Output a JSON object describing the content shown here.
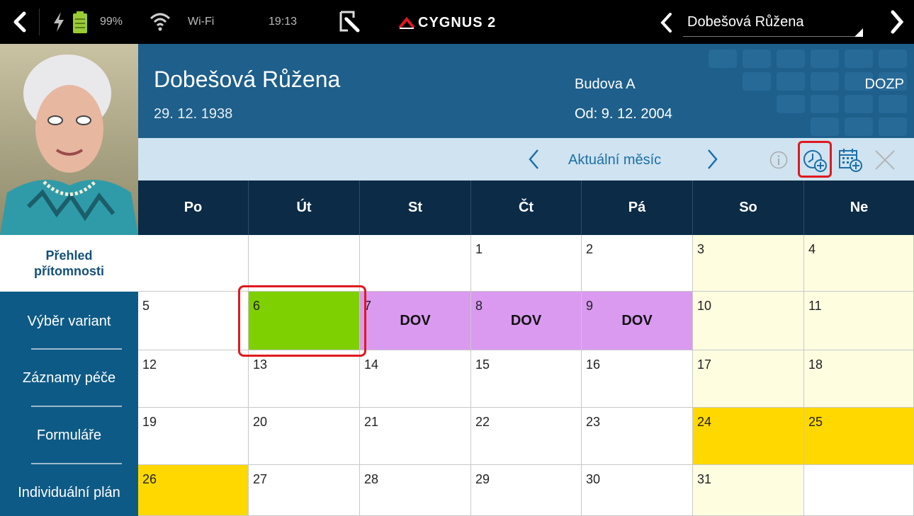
{
  "status_bar": {
    "battery_percent": "99%",
    "wifi_label": "Wi-Fi",
    "time": "19:13",
    "app_logo": "CYGNUS 2",
    "selected_patient": "Dobešová Růžena"
  },
  "patient": {
    "name": "Dobešová Růžena",
    "birth_date": "29. 12. 1938",
    "building": "Budova A",
    "since": "Od: 9. 12. 2004",
    "service": "DOZP"
  },
  "month_nav": {
    "label": "Aktuální měsíc"
  },
  "sidebar": {
    "active": "Přehled přítomnosti",
    "items": [
      {
        "label": "Výběr variant"
      },
      {
        "label": "Záznamy péče"
      },
      {
        "label": "Formuláře"
      },
      {
        "label": "Individuální plán"
      }
    ]
  },
  "calendar": {
    "weekdays": [
      "Po",
      "Út",
      "St",
      "Čt",
      "Pá",
      "So",
      "Ne"
    ],
    "weeks": [
      [
        {
          "day": ""
        },
        {
          "day": ""
        },
        {
          "day": ""
        },
        {
          "day": "1"
        },
        {
          "day": "2"
        },
        {
          "day": "3",
          "kind": "weekend"
        },
        {
          "day": "4",
          "kind": "weekend"
        }
      ],
      [
        {
          "day": "5"
        },
        {
          "day": "6",
          "kind": "present"
        },
        {
          "day": "7",
          "kind": "leave",
          "tag": "DOV"
        },
        {
          "day": "8",
          "kind": "leave",
          "tag": "DOV"
        },
        {
          "day": "9",
          "kind": "leave",
          "tag": "DOV"
        },
        {
          "day": "10",
          "kind": "weekend"
        },
        {
          "day": "11",
          "kind": "weekend"
        }
      ],
      [
        {
          "day": "12"
        },
        {
          "day": "13"
        },
        {
          "day": "14"
        },
        {
          "day": "15"
        },
        {
          "day": "16"
        },
        {
          "day": "17",
          "kind": "weekend"
        },
        {
          "day": "18",
          "kind": "weekend"
        }
      ],
      [
        {
          "day": "19"
        },
        {
          "day": "20"
        },
        {
          "day": "21"
        },
        {
          "day": "22"
        },
        {
          "day": "23"
        },
        {
          "day": "24",
          "kind": "holiday"
        },
        {
          "day": "25",
          "kind": "holiday"
        }
      ],
      [
        {
          "day": "26",
          "kind": "holiday"
        },
        {
          "day": "27"
        },
        {
          "day": "28"
        },
        {
          "day": "29"
        },
        {
          "day": "30"
        },
        {
          "day": "31",
          "kind": "weekend"
        },
        {
          "day": ""
        }
      ]
    ]
  },
  "colors": {
    "present": "#7ed000",
    "leave": "#d99af0",
    "weekend": "#fffde0",
    "holiday": "#ffd800",
    "header": "#1e5f8b",
    "dark": "#0b2b47",
    "highlight": "#e0191e"
  },
  "icons": [
    "back-icon",
    "bolt-icon",
    "battery-icon",
    "wifi-icon",
    "edit-icon",
    "chevron-left-icon",
    "chevron-right-icon",
    "info-icon",
    "add-time-icon",
    "add-calendar-icon",
    "close-icon"
  ]
}
